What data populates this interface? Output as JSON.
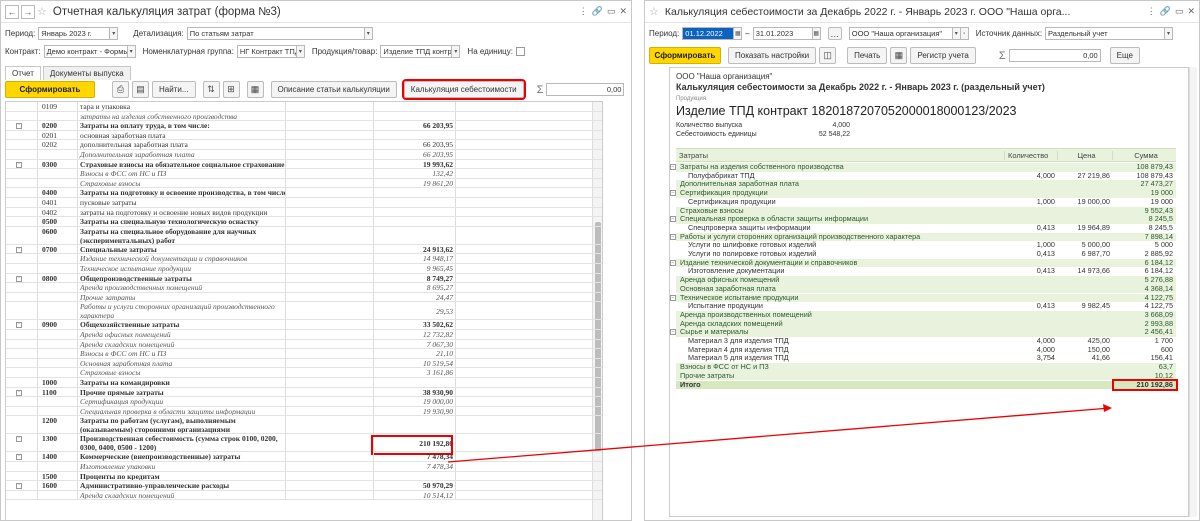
{
  "left": {
    "title": "Отчетная калькуляция затрат (форма №3)",
    "period_label": "Период:",
    "period_value": "Январь 2023 г.",
    "detail_label": "Детализация:",
    "detail_value": "По статьям затрат",
    "contract_label": "Контракт:",
    "contract_value": "Демо контракт - Формы РКМ",
    "nomgroup_label": "Номенклатурная группа:",
    "nomgroup_value": "НГ Контракт ТПД",
    "product_label": "Продукция/товар:",
    "product_value": "Изделие ТПД контракт",
    "unit_label": "На единицу:",
    "tabs": [
      "Отчет",
      "Документы выпуска"
    ],
    "btn_form": "Сформировать",
    "btn_find": "Найти...",
    "btn_describe": "Описание статьи калькуляции",
    "btn_calc": "Калькуляция себестоимости",
    "sum_symbol": "Σ",
    "sum_value": "0,00",
    "rows": [
      {
        "code": "0109",
        "name": "тара и упаковка",
        "val": "",
        "style": "n"
      },
      {
        "code": "",
        "name": "затраты на изделия собственного производства",
        "val": "",
        "style": "i"
      },
      {
        "code": "0200",
        "name": "Затраты на оплату труда, в том числе:",
        "val": "66 203,95",
        "style": "b"
      },
      {
        "code": "0201",
        "name": "основная заработная плата",
        "val": "",
        "style": "n"
      },
      {
        "code": "0202",
        "name": "дополнительная заработная плата",
        "val": "66 203,95",
        "style": "n"
      },
      {
        "code": "",
        "name": "Дополнительная заработная плата",
        "val": "66 203,95",
        "style": "i"
      },
      {
        "code": "0300",
        "name": "Страховые взносы на обязательное социальное страхование",
        "val": "19 993,62",
        "style": "b"
      },
      {
        "code": "",
        "name": "Взносы в ФСС от НС и ПЗ",
        "val": "132,42",
        "style": "i"
      },
      {
        "code": "",
        "name": "Страховые взносы",
        "val": "19 861,20",
        "style": "i"
      },
      {
        "code": "0400",
        "name": "Затраты на подготовку и освоение производства, в том числе:",
        "val": "",
        "style": "b"
      },
      {
        "code": "0401",
        "name": "пусковые затраты",
        "val": "",
        "style": "n"
      },
      {
        "code": "0402",
        "name": "затраты на подготовку и освоение новых видов продукции",
        "val": "",
        "style": "n"
      },
      {
        "code": "0500",
        "name": "Затраты на специальную технологическую оснастку",
        "val": "",
        "style": "b"
      },
      {
        "code": "0600",
        "name": "Затраты на специальное оборудование для научных (экспериментальных) работ",
        "val": "",
        "style": "bw"
      },
      {
        "code": "0700",
        "name": "Специальные затраты",
        "val": "24 913,62",
        "style": "b"
      },
      {
        "code": "",
        "name": "Издание технической документации и справочников",
        "val": "14 948,17",
        "style": "i"
      },
      {
        "code": "",
        "name": "Техническое испытание продукции",
        "val": "9 965,45",
        "style": "i"
      },
      {
        "code": "0800",
        "name": "Общепроизводственные затраты",
        "val": "8 749,27",
        "style": "b"
      },
      {
        "code": "",
        "name": "Аренда производственных помещений",
        "val": "8 695,27",
        "style": "i"
      },
      {
        "code": "",
        "name": "Прочие затраты",
        "val": "24,47",
        "style": "i"
      },
      {
        "code": "",
        "name": "Работы и услуги сторонних организаций производственного характера",
        "val": "29,53",
        "style": "iw"
      },
      {
        "code": "0900",
        "name": "Общехозяйственные затраты",
        "val": "33 502,62",
        "style": "b"
      },
      {
        "code": "",
        "name": "Аренда офисных помещений",
        "val": "12 732,82",
        "style": "i"
      },
      {
        "code": "",
        "name": "Аренда складских помещений",
        "val": "7 067,30",
        "style": "i"
      },
      {
        "code": "",
        "name": "Взносы в ФСС от НС и ПЗ",
        "val": "21,10",
        "style": "i"
      },
      {
        "code": "",
        "name": "Основная заработная плата",
        "val": "10 519,54",
        "style": "i"
      },
      {
        "code": "",
        "name": "Страховые взносы",
        "val": "3 161,86",
        "style": "i"
      },
      {
        "code": "1000",
        "name": "Затраты на командировки",
        "val": "",
        "style": "b"
      },
      {
        "code": "1100",
        "name": "Прочие прямые затраты",
        "val": "38 930,90",
        "style": "b"
      },
      {
        "code": "",
        "name": "Сертификация продукции",
        "val": "19 000,00",
        "style": "i"
      },
      {
        "code": "",
        "name": "Специальная проверка в области защиты информации",
        "val": "19 930,90",
        "style": "i"
      },
      {
        "code": "1200",
        "name": "Затраты по работам (услугам), выполняемым (оказываемым) сторонними организациями",
        "val": "",
        "style": "bw"
      },
      {
        "code": "1300",
        "name": "Производственная себестоимость (сумма строк 0100, 0200, 0300, 0400, 0500 - 1200)",
        "val": "210 192,86",
        "style": "bw"
      },
      {
        "code": "1400",
        "name": "Коммерческие (внепроизводственные) затраты",
        "val": "7 478,34",
        "style": "b"
      },
      {
        "code": "",
        "name": "Изготовление упаковки",
        "val": "7 478,34",
        "style": "i"
      },
      {
        "code": "1500",
        "name": "Проценты по кредитам",
        "val": "",
        "style": "b"
      },
      {
        "code": "1600",
        "name": "Административно-управленческие расходы",
        "val": "50 970,29",
        "style": "b"
      },
      {
        "code": "",
        "name": "Аренда складских помещений",
        "val": "10 514,12",
        "style": "i"
      }
    ]
  },
  "right": {
    "title": "Калькуляция себестоимости за Декабрь 2022 г. - Январь 2023 г. ООО \"Наша орга...",
    "period_label": "Период:",
    "date_from": "01.12.2022",
    "date_to": "31.01.2023",
    "org_value": "ООО \"Наша организация\"",
    "source_label": "Источник данных:",
    "source_value": "Раздельный учет",
    "btn_form": "Сформировать",
    "btn_settings": "Показать настройки",
    "btn_print": "Печать",
    "btn_register": "Регистр учета",
    "sum_symbol": "Σ",
    "sum_value": "0,00",
    "btn_more": "Еще",
    "org_name": "ООО \"Наша организация\"",
    "report_title": "Калькуляция себестоимости за Декабрь 2022 г. - Январь 2023 г. (раздельный учет)",
    "product_caption": "Продукция",
    "product_name": "Изделие ТПД контракт 1820187207052000018000123/2023",
    "qty_label": "Количество выпуска",
    "qty_value": "4,000",
    "unit_cost_label": "Себестоимость единицы",
    "unit_cost_value": "52 548,22",
    "cols": [
      "Затраты",
      "Количество",
      "Цена",
      "Сумма"
    ],
    "rows": [
      {
        "name": "Затраты на изделия собственного производства",
        "qty": "",
        "price": "",
        "sum": "108 879,43",
        "t": "grp"
      },
      {
        "name": "Полуфабрикат ТПД",
        "qty": "4,000",
        "price": "27 219,86",
        "sum": "108 879,43",
        "t": "sub"
      },
      {
        "name": "Дополнительная заработная плата",
        "qty": "",
        "price": "",
        "sum": "27 473,27",
        "t": "grp"
      },
      {
        "name": "Сертификация продукции",
        "qty": "",
        "price": "",
        "sum": "19 000",
        "t": "grp"
      },
      {
        "name": "Сертификация продукции",
        "qty": "1,000",
        "price": "19 000,00",
        "sum": "19 000",
        "t": "sub"
      },
      {
        "name": "Страховые взносы",
        "qty": "",
        "price": "",
        "sum": "9 552,43",
        "t": "grp"
      },
      {
        "name": "Специальная проверка в области защиты информации",
        "qty": "",
        "price": "",
        "sum": "8 245,5",
        "t": "grp"
      },
      {
        "name": "Спецпроверка защиты информации",
        "qty": "0,413",
        "price": "19 964,89",
        "sum": "8 245,5",
        "t": "sub"
      },
      {
        "name": "Работы и услуги сторонних организаций производственного характера",
        "qty": "",
        "price": "",
        "sum": "7 898,14",
        "t": "grp"
      },
      {
        "name": "Услуги по шлифовке готовых изделий",
        "qty": "1,000",
        "price": "5 000,00",
        "sum": "5 000",
        "t": "sub"
      },
      {
        "name": "Услуги по полировке готовых изделий",
        "qty": "0,413",
        "price": "6 987,70",
        "sum": "2 885,92",
        "t": "sub"
      },
      {
        "name": "Издание технической документации и справочников",
        "qty": "",
        "price": "",
        "sum": "6 184,12",
        "t": "grp"
      },
      {
        "name": "Изготовление документации",
        "qty": "0,413",
        "price": "14 973,66",
        "sum": "6 184,12",
        "t": "sub"
      },
      {
        "name": "Аренда офисных помещений",
        "qty": "",
        "price": "",
        "sum": "5 276,88",
        "t": "grp"
      },
      {
        "name": "Основная заработная плата",
        "qty": "",
        "price": "",
        "sum": "4 368,14",
        "t": "grp"
      },
      {
        "name": "Техническое испытание продукции",
        "qty": "",
        "price": "",
        "sum": "4 122,75",
        "t": "grp"
      },
      {
        "name": "Испытание продукции",
        "qty": "0,413",
        "price": "9 982,45",
        "sum": "4 122,75",
        "t": "sub"
      },
      {
        "name": "Аренда производственных помещений",
        "qty": "",
        "price": "",
        "sum": "3 668,09",
        "t": "grp"
      },
      {
        "name": "Аренда складских помещений",
        "qty": "",
        "price": "",
        "sum": "2 993,88",
        "t": "grp"
      },
      {
        "name": "Сырье и материалы",
        "qty": "",
        "price": "",
        "sum": "2 456,41",
        "t": "grp"
      },
      {
        "name": "Материал 3 для изделия ТПД",
        "qty": "4,000",
        "price": "425,00",
        "sum": "1 700",
        "t": "sub"
      },
      {
        "name": "Материал 4 для изделия ТПД",
        "qty": "4,000",
        "price": "150,00",
        "sum": "600",
        "t": "sub"
      },
      {
        "name": "Материал 5 для изделия ТПД",
        "qty": "3,754",
        "price": "41,66",
        "sum": "156,41",
        "t": "sub"
      },
      {
        "name": "Взносы в ФСС от НС и ПЗ",
        "qty": "",
        "price": "",
        "sum": "63,7",
        "t": "grp"
      },
      {
        "name": "Прочие затраты",
        "qty": "",
        "price": "",
        "sum": "10,12",
        "t": "grp"
      },
      {
        "name": "Итого",
        "qty": "",
        "price": "",
        "sum": "210 192,86",
        "t": "tot"
      }
    ]
  },
  "colors": {
    "accent_yellow": "#ffd600",
    "highlight_red": "#e00000",
    "group_green": "#e8f2dc",
    "selection_blue": "#0b63c1"
  }
}
